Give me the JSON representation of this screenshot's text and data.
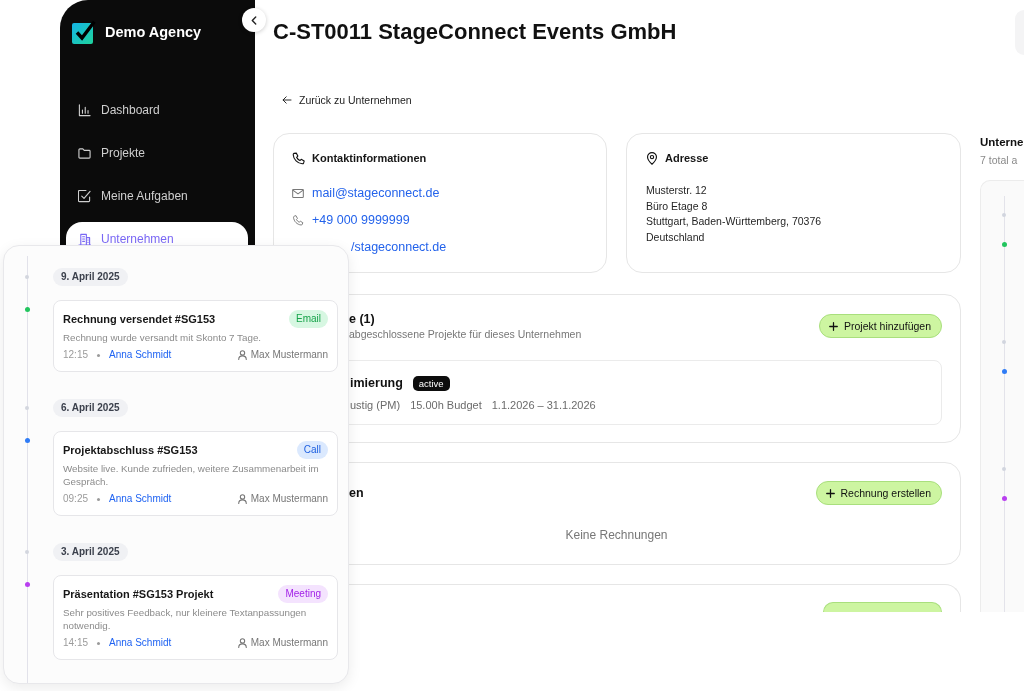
{
  "sidebar": {
    "brand": "Demo Agency",
    "items": [
      {
        "label": "Dashboard",
        "selected": false
      },
      {
        "label": "Projekte",
        "selected": false
      },
      {
        "label": "Meine Aufgaben",
        "selected": false
      },
      {
        "label": "Unternehmen",
        "selected": true
      }
    ]
  },
  "header": {
    "title": "C-ST0011 StageConnect Events GmbH",
    "back_link": "Zurück zu Unternehmen"
  },
  "contact": {
    "title": "Kontaktinformationen",
    "email": "mail@stageconnect.de",
    "phone": "+49 000 9999999",
    "website": "/stageconnect.de"
  },
  "address": {
    "title": "Adresse",
    "lines": [
      "Musterstr. 12",
      "Büro Etage 8",
      "Stuttgart, Baden-Württemberg, 70376",
      "Deutschland"
    ]
  },
  "projects": {
    "title": "e (1)",
    "subtitle": "abgeschlossene Projekte für dieses Unternehmen",
    "button": "Projekt hinzufügen",
    "items": [
      {
        "name": "imierung",
        "status": "active",
        "manager": "ustig (PM)",
        "budget": "15.00h Budget",
        "period": "1.1.2026 – 31.1.2026"
      }
    ]
  },
  "invoices": {
    "title": "en",
    "button": "Rechnung erstellen",
    "empty_text": "Keine Rechnungen"
  },
  "activity": {
    "title": "Unterne",
    "subtitle": "7 total a",
    "markers": [
      {
        "kind": "date",
        "color": "#d1d5de"
      },
      {
        "kind": "entry",
        "color": "#22c55e"
      },
      {
        "kind": "date",
        "color": "#d1d5de"
      },
      {
        "kind": "entry",
        "color": "#2f7cf6"
      },
      {
        "kind": "date",
        "color": "#d1d5de"
      },
      {
        "kind": "entry",
        "color": "#b93ff0"
      }
    ]
  },
  "timeline": {
    "groups": [
      {
        "date": "9. April 2025",
        "entries": [
          {
            "title": "Rechnung versendet #SG153",
            "tag": "Email",
            "kind": "email",
            "color": "#22c55e",
            "description": "Rechnung wurde versandt mit Skonto 7 Tage.",
            "time": "12:15",
            "author": "Anna Schmidt",
            "assignee": "Max Mustermann"
          }
        ]
      },
      {
        "date": "6. April 2025",
        "entries": [
          {
            "title": "Projektabschluss #SG153",
            "tag": "Call",
            "kind": "call",
            "color": "#2f7cf6",
            "description": "Website live. Kunde zufrieden, weitere Zusammenarbeit im Gespräch.",
            "time": "09:25",
            "author": "Anna Schmidt",
            "assignee": "Max Mustermann"
          }
        ]
      },
      {
        "date": "3. April 2025",
        "entries": [
          {
            "title": "Präsentation #SG153 Projekt",
            "tag": "Meeting",
            "kind": "meeting",
            "color": "#b93ff0",
            "description": "Sehr positives Feedback, nur kleinere Textanpassungen notwendig.",
            "time": "14:15",
            "author": "Anna Schmidt",
            "assignee": "Max Mustermann"
          }
        ]
      }
    ]
  }
}
